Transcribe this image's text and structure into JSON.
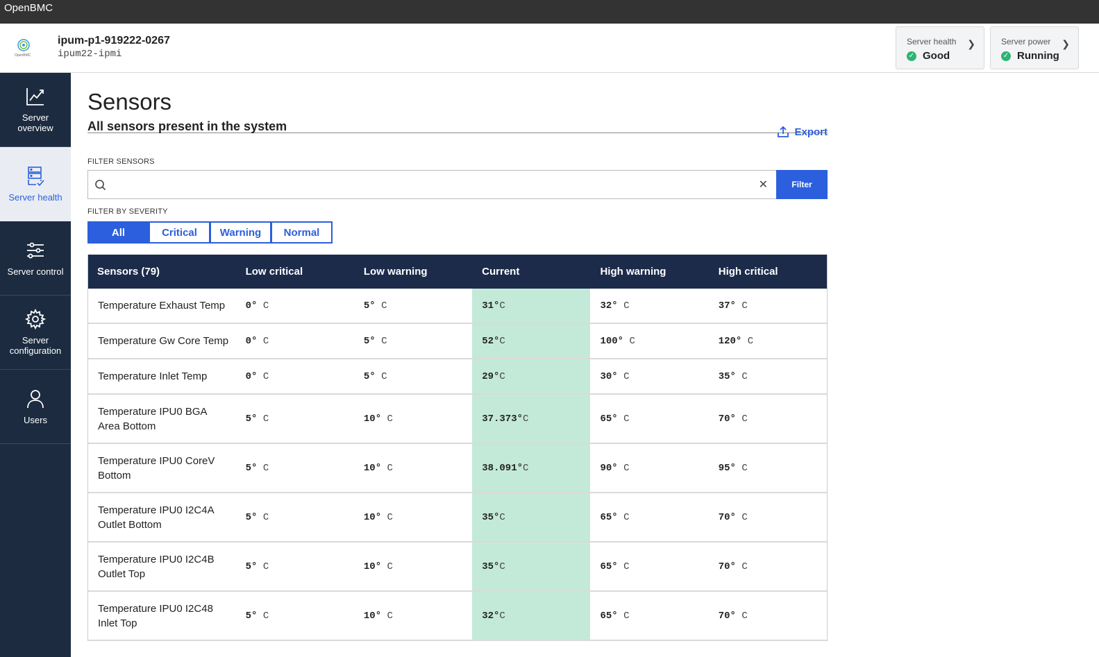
{
  "window": {
    "title": "OpenBMC"
  },
  "header": {
    "hostname": "ipum-p1-919222-0267",
    "subname": "ipum22-ipmi",
    "server_health": {
      "label": "Server health",
      "value": "Good"
    },
    "server_power": {
      "label": "Server power",
      "value": "Running"
    }
  },
  "sidebar": {
    "items": [
      {
        "label": "Server overview",
        "icon": "chart-icon"
      },
      {
        "label": "Server health",
        "icon": "server-check-icon",
        "active": true
      },
      {
        "label": "Server control",
        "icon": "sliders-icon"
      },
      {
        "label": "Server configuration",
        "icon": "gear-icon"
      },
      {
        "label": "Users",
        "icon": "user-icon"
      }
    ]
  },
  "page": {
    "title": "Sensors",
    "subtitle": "All sensors present in the system",
    "export_label": "Export",
    "filter_label": "FILTER SENSORS",
    "search_value": "",
    "filter_button": "Filter",
    "severity_label": "FILTER BY SEVERITY",
    "severity": [
      "All",
      "Critical",
      "Warning",
      "Normal"
    ],
    "severity_selected": "All"
  },
  "table": {
    "headers": [
      "Sensors (79)",
      "Low critical",
      "Low warning",
      "Current",
      "High warning",
      "High critical"
    ],
    "rows": [
      {
        "name": "Temperature Exhaust Temp",
        "low_critical": "0°",
        "low_warning": "5°",
        "current": "31°",
        "high_warning": "32°",
        "high_critical": "37°"
      },
      {
        "name": "Temperature Gw Core Temp",
        "low_critical": "0°",
        "low_warning": "5°",
        "current": "52°",
        "high_warning": "100°",
        "high_critical": "120°"
      },
      {
        "name": "Temperature Inlet Temp",
        "low_critical": "0°",
        "low_warning": "5°",
        "current": "29°",
        "high_warning": "30°",
        "high_critical": "35°"
      },
      {
        "name": "Temperature IPU0 BGA Area Bottom",
        "low_critical": "5°",
        "low_warning": "10°",
        "current": "37.373°",
        "high_warning": "65°",
        "high_critical": "70°"
      },
      {
        "name": "Temperature IPU0 CoreV Bottom",
        "low_critical": "5°",
        "low_warning": "10°",
        "current": "38.091°",
        "high_warning": "90°",
        "high_critical": "95°"
      },
      {
        "name": "Temperature IPU0 I2C4A Outlet Bottom",
        "low_critical": "5°",
        "low_warning": "10°",
        "current": "35°",
        "high_warning": "65°",
        "high_critical": "70°"
      },
      {
        "name": "Temperature IPU0 I2C4B Outlet Top",
        "low_critical": "5°",
        "low_warning": "10°",
        "current": "35°",
        "high_warning": "65°",
        "high_critical": "70°"
      },
      {
        "name": "Temperature IPU0 I2C48 Inlet Top",
        "low_critical": "5°",
        "low_warning": "10°",
        "current": "32°",
        "high_warning": "65°",
        "high_critical": "70°"
      }
    ],
    "unit": "C",
    "row_heights": [
      51,
      51,
      51,
      71,
      71,
      71,
      71,
      71
    ]
  },
  "colors": {
    "accent": "#2b5fdd",
    "sidebar_bg": "#1c2b40",
    "table_header_bg": "#1c2b4a",
    "current_ok_bg": "#c3ead8",
    "status_ok": "#2db572"
  }
}
